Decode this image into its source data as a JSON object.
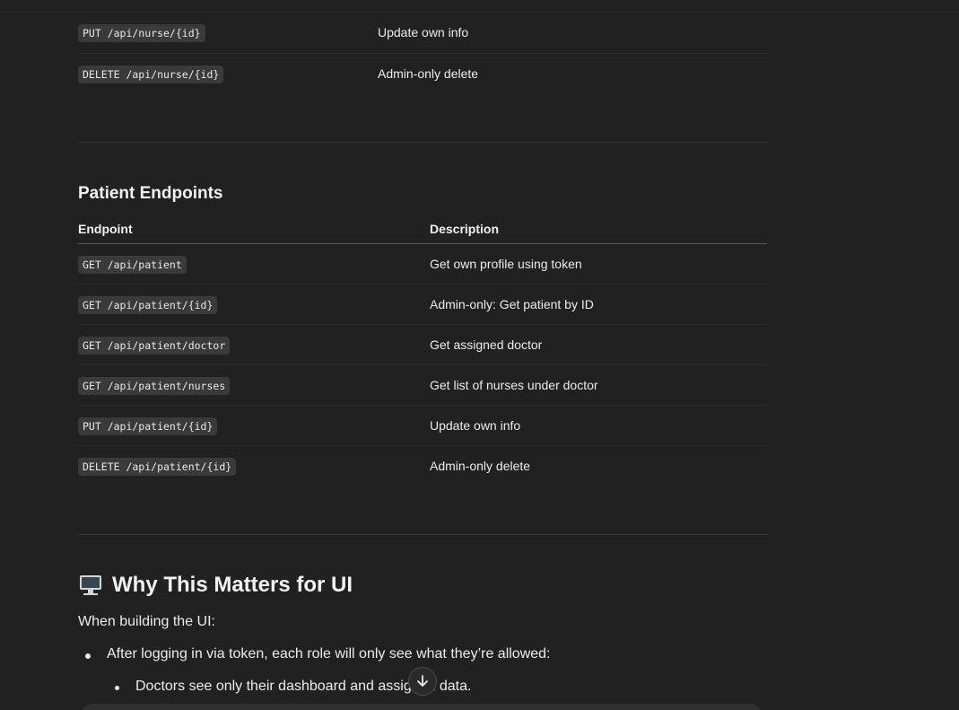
{
  "nurse_table": {
    "rows": [
      {
        "endpoint": "PUT /api/nurse/{id}",
        "description": "Update own info"
      },
      {
        "endpoint": "DELETE /api/nurse/{id}",
        "description": "Admin-only delete"
      }
    ]
  },
  "patient_section": {
    "title": "Patient Endpoints",
    "headers": {
      "endpoint": "Endpoint",
      "description": "Description"
    },
    "rows": [
      {
        "endpoint": "GET /api/patient",
        "description": "Get own profile using token"
      },
      {
        "endpoint": "GET /api/patient/{id}",
        "description": "Admin-only: Get patient by ID"
      },
      {
        "endpoint": "GET /api/patient/doctor",
        "description": "Get assigned doctor"
      },
      {
        "endpoint": "GET /api/patient/nurses",
        "description": "Get list of nurses under doctor"
      },
      {
        "endpoint": "PUT /api/patient/{id}",
        "description": "Update own info"
      },
      {
        "endpoint": "DELETE /api/patient/{id}",
        "description": "Admin-only delete"
      }
    ]
  },
  "why_section": {
    "icon": "desktop-computer-icon",
    "title": "Why This Matters for UI",
    "lead": "When building the UI:",
    "bullets": [
      {
        "text": "After logging in via token, each role will only see what they’re allowed:"
      }
    ],
    "sub_bullets": [
      {
        "text": "Doctors see only their dashboard and assigned data."
      }
    ]
  },
  "controls": {
    "scroll_down_icon": "arrow-down-icon"
  }
}
